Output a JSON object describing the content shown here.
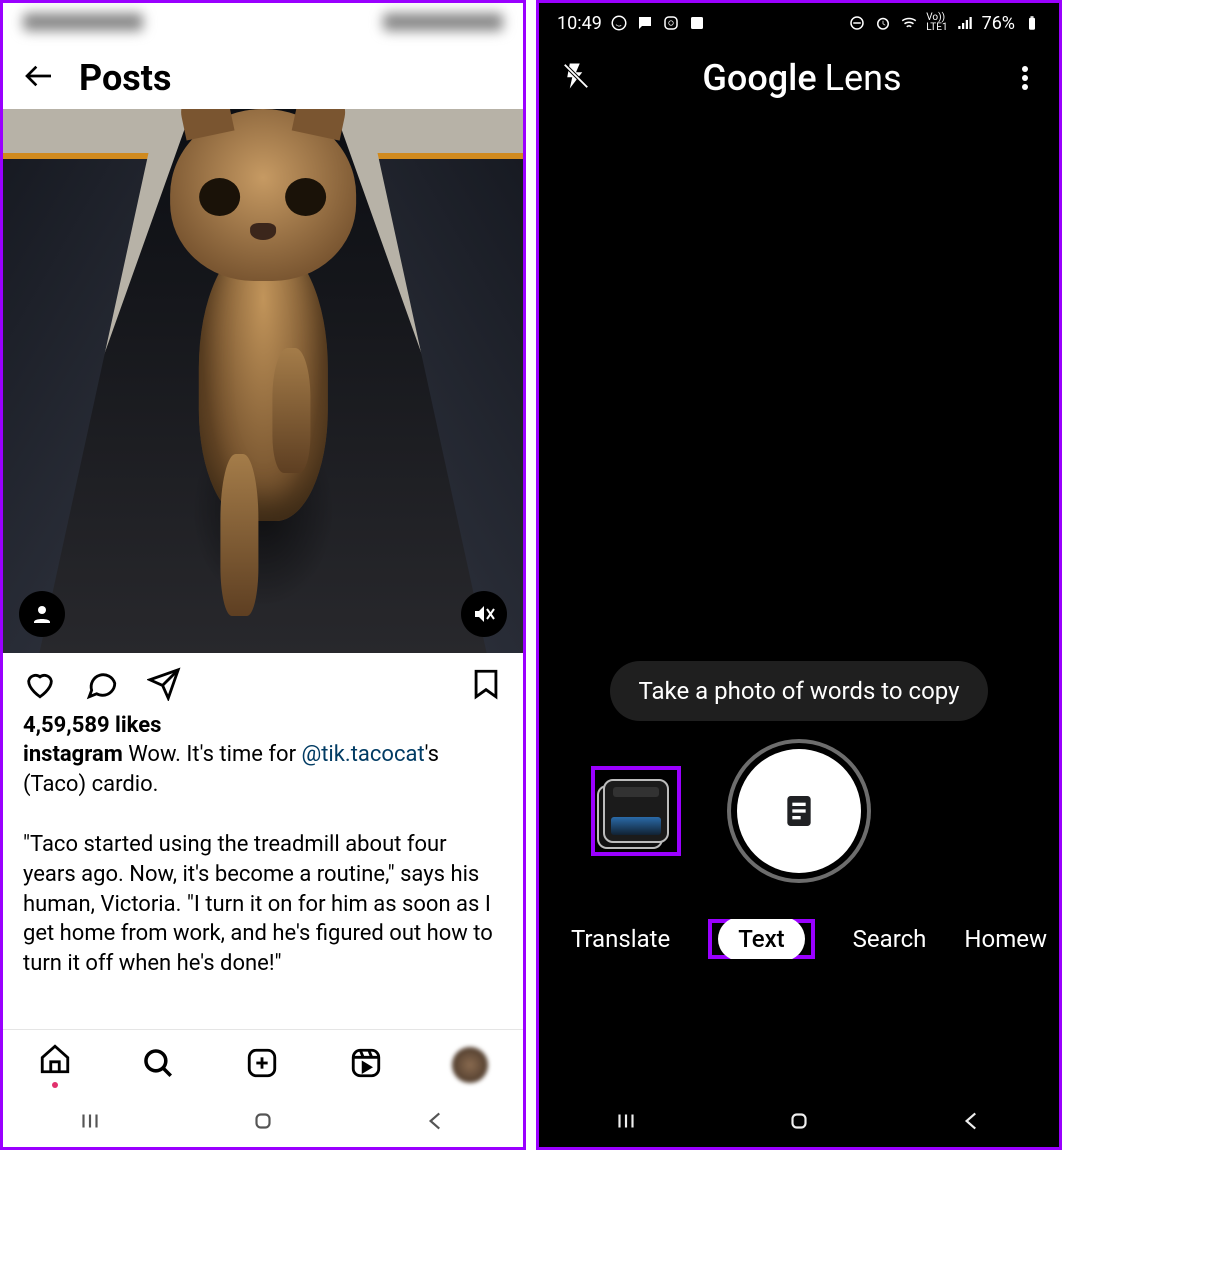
{
  "left": {
    "header_title": "Posts",
    "likes_text": "4,59,589 likes",
    "caption_user": "instagram",
    "caption_line1_a": " Wow. It's time for ",
    "caption_mention": "@tik.tacocat",
    "caption_line1_b": "'s (Taco) cardio.",
    "caption_body": "\"Taco started using the treadmill about four years ago. Now, it's become a routine,\" says his human, Victoria. \"I turn it on for him as soon as I get home from work, and he's figured out how to turn it off when he's done!\"",
    "icons": {
      "back": "back-arrow-icon",
      "tag": "person-tag-icon",
      "mute": "muted-icon",
      "like": "heart-icon",
      "comment": "comment-icon",
      "share": "share-icon",
      "save": "bookmark-icon",
      "nav_home": "home-icon",
      "nav_search": "search-icon",
      "nav_add": "add-post-icon",
      "nav_reels": "reels-icon",
      "nav_profile": "profile-avatar"
    }
  },
  "right": {
    "status_time": "10:49",
    "status_battery": "76%",
    "status_net": "LTE1",
    "status_vo": "Vo))",
    "logo_google": "Google",
    "logo_lens": "Lens",
    "hint": "Take a photo of words to copy",
    "modes": {
      "translate": "Translate",
      "text": "Text",
      "search": "Search",
      "homework": "Homew"
    },
    "icons": {
      "flash_off": "flash-off-icon",
      "more": "more-vert-icon",
      "gallery": "gallery-thumbnail",
      "shutter_doc": "document-icon"
    }
  },
  "sysbar": {
    "recents": "recents-icon",
    "home": "home-pill-icon",
    "back": "back-icon"
  }
}
